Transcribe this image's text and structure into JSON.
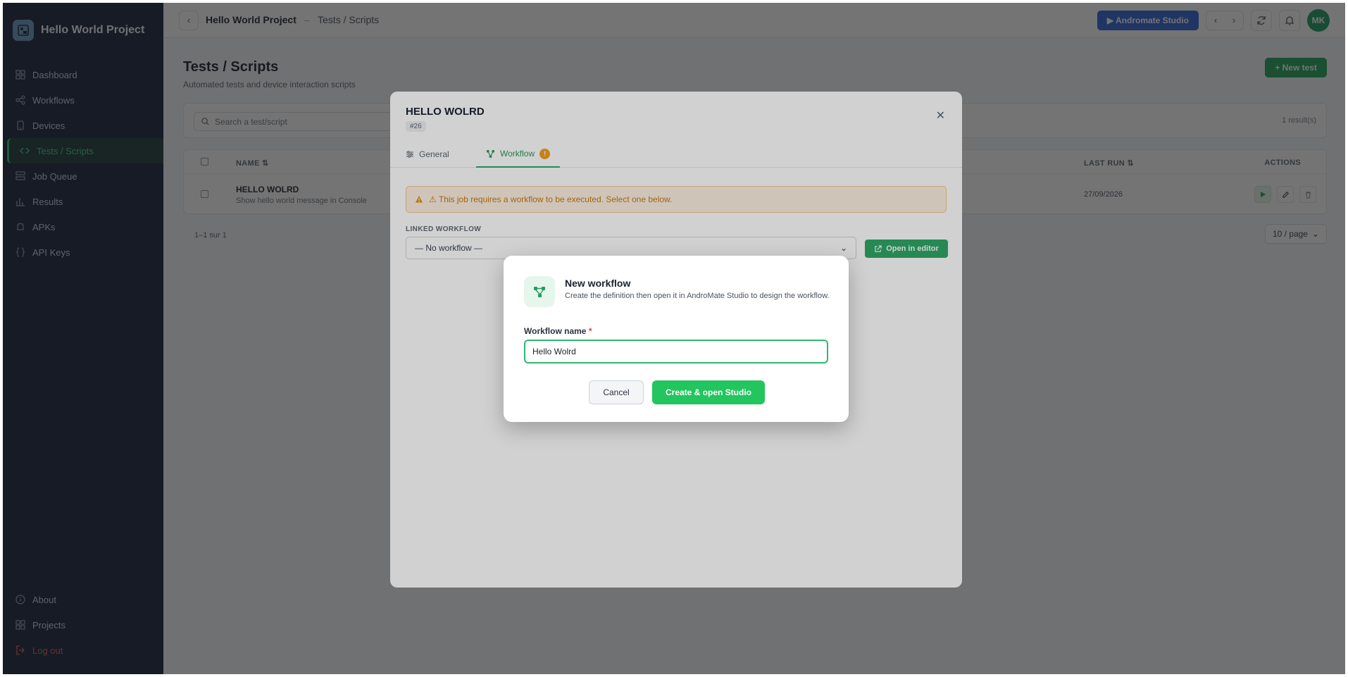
{
  "sidebar": {
    "project_name": "Hello World Project",
    "items": [
      {
        "label": "Dashboard",
        "icon": "grid-icon"
      },
      {
        "label": "Workflows",
        "icon": "share-icon"
      },
      {
        "label": "Devices",
        "icon": "phone-icon"
      },
      {
        "label": "Tests / Scripts",
        "icon": "code-icon"
      },
      {
        "label": "Job Queue",
        "icon": "list-icon"
      },
      {
        "label": "Results",
        "icon": "bar-chart-icon"
      },
      {
        "label": "APKs",
        "icon": "android-icon"
      },
      {
        "label": "API Keys",
        "icon": "braces-icon"
      }
    ],
    "bottom_items": [
      {
        "label": "About",
        "icon": "info-icon"
      },
      {
        "label": "Projects",
        "icon": "grid-icon"
      },
      {
        "label": "Log out",
        "icon": "logout-icon"
      }
    ]
  },
  "topbar": {
    "breadcrumb_project": "Hello World Project",
    "breadcrumb_separator": "–",
    "breadcrumb_page": "Tests / Scripts",
    "studio_button": "▶ Andromate Studio",
    "avatar_initials": "MK"
  },
  "page": {
    "title": "Tests / Scripts",
    "subtitle": "Automated tests and device interaction scripts",
    "new_button": "+ New test",
    "search_placeholder": "Search a test/script",
    "result_count": "1 result(s)",
    "columns": {
      "name": "NAME",
      "last_run": "LAST RUN",
      "actions": "ACTIONS"
    },
    "rows": [
      {
        "name": "HELLO WOLRD",
        "description": "Show hello world message in Console",
        "last_run": "27/09/2026"
      }
    ],
    "pagination": "1–1 sur 1",
    "per_page": "10 / page"
  },
  "job_modal": {
    "title": "HELLO WOLRD",
    "id": "#26",
    "tabs": [
      {
        "label": "General"
      },
      {
        "label": "Workflow",
        "badge": "!"
      }
    ],
    "warning": "⚠ This job requires a workflow to be executed. Select one below.",
    "linked_label": "LINKED WORKFLOW",
    "select_value": "— No workflow —",
    "open_editor": "Open in editor"
  },
  "dialog": {
    "title": "New workflow",
    "description": "Create the definition then open it in AndroMate Studio to design the workflow.",
    "field_label": "Workflow name",
    "required_mark": "*",
    "field_value": "Hello Wolrd",
    "cancel": "Cancel",
    "create": "Create & open Studio"
  },
  "colors": {
    "sidebar_bg": "#1b2740",
    "accent_green": "#22c55e",
    "studio_blue": "#2f64d6",
    "warning": "#f0a020"
  }
}
